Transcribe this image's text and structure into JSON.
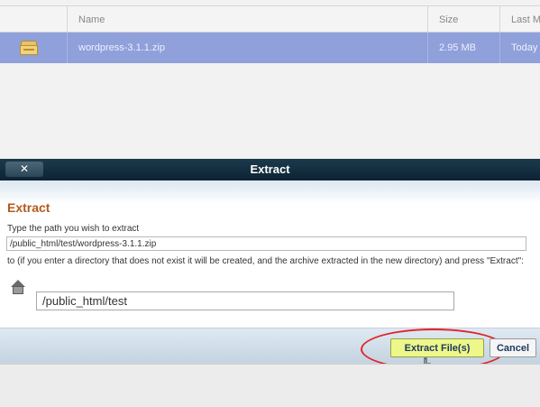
{
  "file_list": {
    "columns": [
      "Name",
      "Size",
      "Last M"
    ],
    "rows": [
      {
        "icon": "zip-archive-icon",
        "name": "wordpress-3.1.1.zip",
        "size": "2.95 MB",
        "last_modified": "Today"
      }
    ]
  },
  "dialog": {
    "close_label": "✕",
    "title": "Extract",
    "heading": "Extract",
    "instruction": "Type the path you wish to extract",
    "path_value": "/public_html/test/wordpress-3.1.1.zip",
    "note": "to (if you enter a directory that does not exist it will be created, and the archive extracted in the new directory) and press \"Extract\":",
    "destination_value": "/public_html/test",
    "extract_button": "Extract File(s)",
    "cancel_button": "Cancel"
  },
  "colors": {
    "selected_row": "#8fa0da",
    "titlebar": "#0c2333",
    "heading": "#b25a1c",
    "extract_button": "#eef78a",
    "highlight_ring": "#e0242a"
  }
}
